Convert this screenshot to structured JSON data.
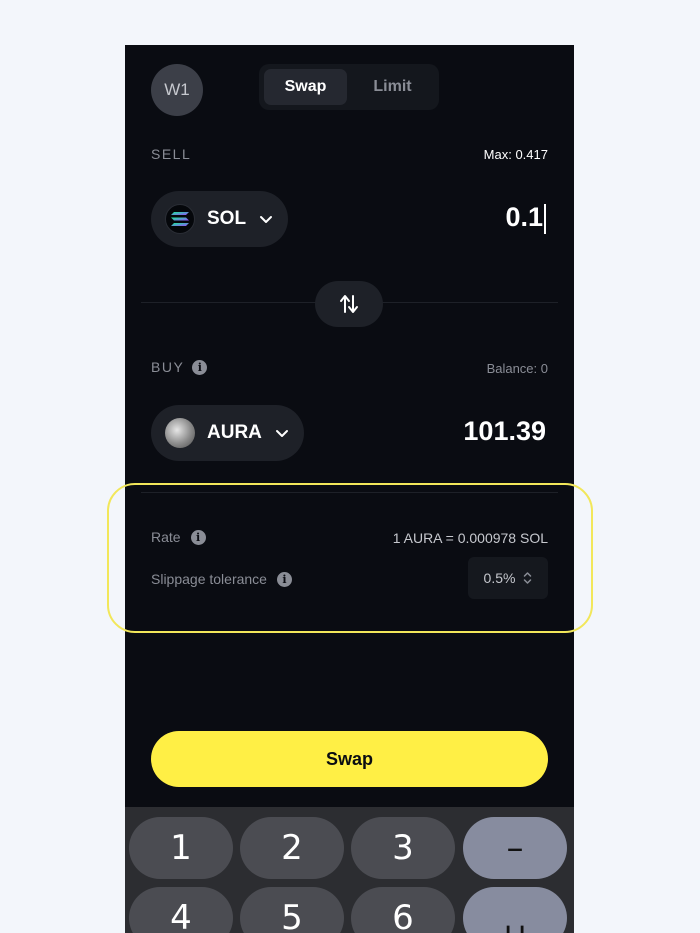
{
  "header": {
    "avatar_label": "W1",
    "tabs": [
      {
        "label": "Swap",
        "active": true
      },
      {
        "label": "Limit",
        "active": false
      }
    ]
  },
  "sell": {
    "label": "SELL",
    "max_text": "Max: 0.417",
    "token": "SOL",
    "amount": "0.1"
  },
  "buy": {
    "label": "BUY",
    "balance_text": "Balance: 0",
    "token": "AURA",
    "amount": "101.39"
  },
  "details": {
    "rate_label": "Rate",
    "rate_value": "1 AURA = 0.000978 SOL",
    "slippage_label": "Slippage tolerance",
    "slippage_value": "0.5%"
  },
  "action": {
    "swap_label": "Swap"
  },
  "keyboard": {
    "keys": [
      "1",
      "2",
      "3",
      "–",
      "4",
      "5",
      "6",
      "␣"
    ]
  },
  "colors": {
    "accent": "#ffef45",
    "background": "#0a0c12",
    "highlight": "#f2e75a"
  },
  "icons": [
    "chevron-down-icon",
    "swap-arrows-icon",
    "info-icon",
    "stepper-icon",
    "sol-token-icon",
    "aura-token-icon"
  ]
}
